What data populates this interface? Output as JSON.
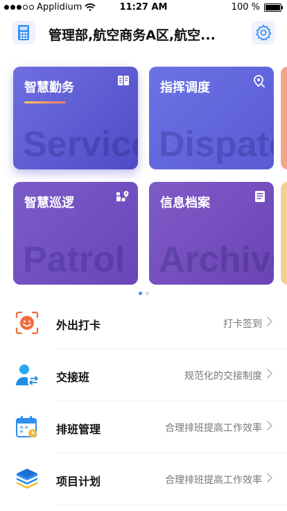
{
  "status_bar": {
    "carrier": "Applidium",
    "time": "11:27 AM",
    "battery": "100 %",
    "signal_filled": 3,
    "signal_total": 5,
    "battery_level": 1.0
  },
  "header": {
    "title": "管理部,航空商务A区,航空..."
  },
  "cards": [
    {
      "title": "智慧勤务",
      "watermark": "Service",
      "icon": "handbook-icon"
    },
    {
      "title": "指挥调度",
      "watermark": "Dispatch",
      "icon": "location-pin-icon"
    },
    {
      "title": "智慧巡逻",
      "watermark": "Patrol",
      "icon": "map-route-icon"
    },
    {
      "title": "信息档案",
      "watermark": "Archive",
      "icon": "document-icon"
    }
  ],
  "pager": {
    "pages": 2,
    "active": 0
  },
  "list": [
    {
      "label": "外出打卡",
      "desc": "打卡签到",
      "icon": "face-clock-icon"
    },
    {
      "label": "交接班",
      "desc": "规范化的交接制度",
      "icon": "user-handover-icon"
    },
    {
      "label": "排班管理",
      "desc": "合理排班提高工作效率",
      "icon": "calendar-icon"
    },
    {
      "label": "项目计划",
      "desc": "合理排班提高工作效率",
      "icon": "layers-icon"
    }
  ],
  "colors": {
    "accent": "#3a8ef6",
    "card_blue": "#5a5ad6",
    "card_purple": "#6b44b3"
  }
}
